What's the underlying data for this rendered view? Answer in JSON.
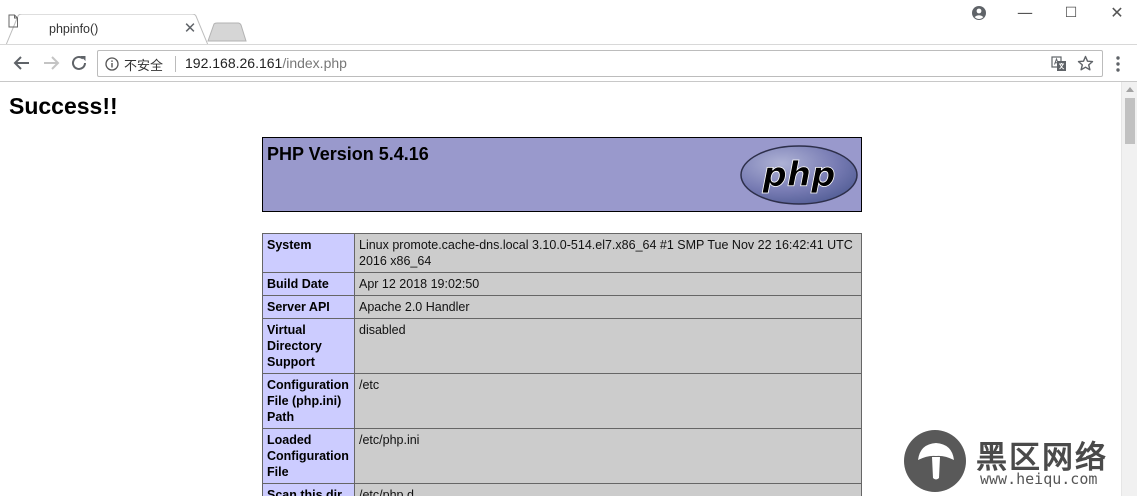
{
  "tab": {
    "title": "phpinfo()",
    "close_glyph": "✕"
  },
  "window": {
    "minimize": "—",
    "maximize": "☐",
    "close": "✕"
  },
  "omnibox": {
    "security_label": "不安全",
    "url_host": "192.168.26.161",
    "url_path": "/index.php"
  },
  "page": {
    "heading": "Success!!",
    "php_version": "PHP Version 5.4.16",
    "logo_text": "php",
    "rows": [
      {
        "key": "System",
        "value": "Linux promote.cache-dns.local 3.10.0-514.el7.x86_64 #1 SMP Tue Nov 22 16:42:41 UTC 2016 x86_64"
      },
      {
        "key": "Build Date",
        "value": "Apr 12 2018 19:02:50"
      },
      {
        "key": "Server API",
        "value": "Apache 2.0 Handler"
      },
      {
        "key": "Virtual Directory Support",
        "value": "disabled"
      },
      {
        "key": "Configuration File (php.ini) Path",
        "value": "/etc"
      },
      {
        "key": "Loaded Configuration File",
        "value": "/etc/php.ini"
      },
      {
        "key": "Scan this dir",
        "value": "/etc/php.d"
      }
    ]
  },
  "watermark": {
    "text": "黑区网络",
    "url": "www.heiqu.com"
  },
  "colors": {
    "header_bg": "#9999cc",
    "key_bg": "#ccccff",
    "value_bg": "#cccccc"
  },
  "icons": [
    "document-icon",
    "back-icon",
    "forward-icon",
    "reload-icon",
    "info-icon",
    "translate-icon",
    "star-icon",
    "menu-icon",
    "account-icon"
  ]
}
